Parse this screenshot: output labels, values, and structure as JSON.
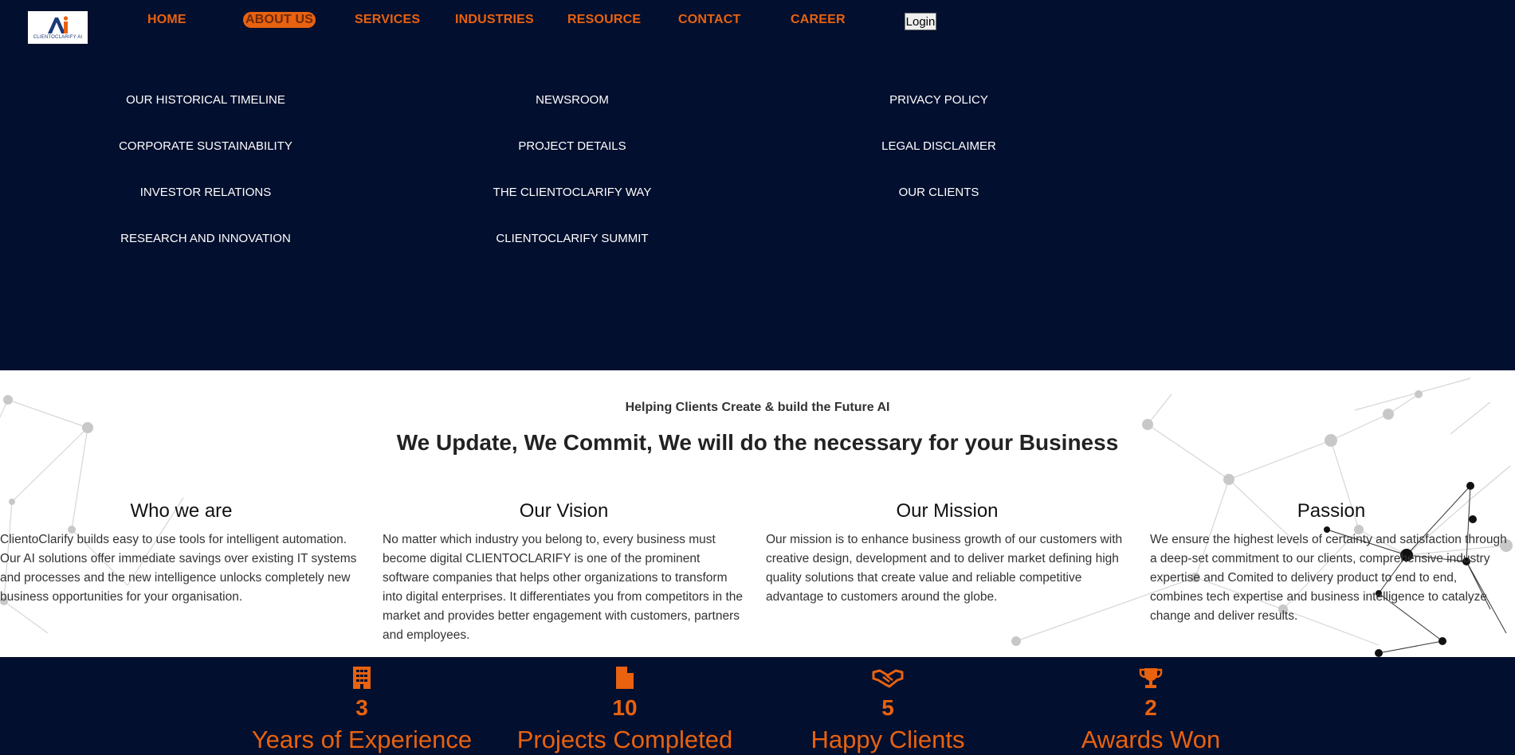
{
  "brand": {
    "logo_text": "CLIENTOCLARIFY AI"
  },
  "nav": {
    "items": [
      {
        "label": "HOME"
      },
      {
        "label": "ABOUT US"
      },
      {
        "label": "SERVICES"
      },
      {
        "label": "INDUSTRIES"
      },
      {
        "label": "RESOURCE"
      },
      {
        "label": "CONTACT"
      },
      {
        "label": "CAREER"
      }
    ],
    "login_label": "Login"
  },
  "dropdown": {
    "col1": [
      "OUR HISTORICAL TIMELINE",
      "CORPORATE SUSTAINABILITY",
      "INVESTOR RELATIONS",
      "RESEARCH AND INNOVATION"
    ],
    "col2": [
      "NEWSROOM",
      "PROJECT DETAILS",
      "THE CLIENTOCLARIFY WAY",
      "CLIENTOCLARIFY SUMMIT"
    ],
    "col3": [
      "PRIVACY POLICY",
      "LEGAL DISCLAIMER",
      "OUR CLIENTS"
    ]
  },
  "about": {
    "tagline": "Helping Clients Create & build the Future AI",
    "headline": "We Update, We Commit, We will do the necessary for your Business",
    "columns": [
      {
        "title": "Who we are",
        "text": "ClientoClarify builds easy to use tools for intelligent automation. Our AI solutions offer immediate savings over existing IT systems and processes and the new intelligence unlocks completely new business opportunities for your organisation."
      },
      {
        "title": "Our Vision",
        "text": "No matter which industry you belong to, every business must become digital CLIENTOCLARIFY is one of the prominent software companies that helps other organizations to transform into digital enterprises. It differentiates you from competitors in the market and provides better engagement with customers, partners and employees."
      },
      {
        "title": "Our Mission",
        "text": "Our mission is to enhance business growth of our customers with creative design, development and to deliver market defining high quality solutions that create value and reliable competitive advantage to customers around the globe."
      },
      {
        "title": "Passion",
        "text": "We ensure the highest levels of certainty and satisfaction through a deep-set commitment to our clients, comprehensive industry expertise and Comited to delivery product to end to end, combines tech expertise and business intelligence to catalyze change and deliver results."
      }
    ]
  },
  "stats": [
    {
      "icon": "building-icon",
      "value": "3",
      "label": "Years of Experience"
    },
    {
      "icon": "document-icon",
      "value": "10",
      "label": "Projects Completed"
    },
    {
      "icon": "handshake-icon",
      "value": "5",
      "label": "Happy Clients"
    },
    {
      "icon": "trophy-icon",
      "value": "2",
      "label": "Awards Won"
    }
  ],
  "colors": {
    "navy": "#030f2e",
    "accent": "#e8620f"
  }
}
